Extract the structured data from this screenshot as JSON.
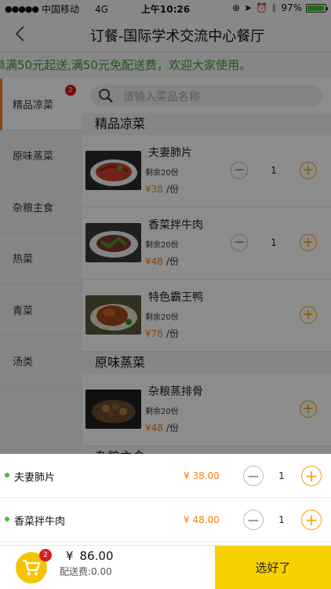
{
  "status_bar": {
    "carrier": "中国移动",
    "network": "4G",
    "time": "上午10:26",
    "battery": "97%",
    "battery_level": 0.97
  },
  "nav": {
    "title": "订餐-国际学术交流中心餐厅"
  },
  "notice": {
    "text": "单满50元起送,满50元免配送费，欢迎大家使用。"
  },
  "sidebar": {
    "categories": [
      {
        "label": "精品凉菜",
        "badge": "2"
      },
      {
        "label": "原味蒸菜"
      },
      {
        "label": "杂粮主食"
      },
      {
        "label": "热菜"
      },
      {
        "label": "青菜"
      },
      {
        "label": "汤类"
      }
    ]
  },
  "search": {
    "placeholder": "请输入菜品名称"
  },
  "sections": [
    {
      "title": "精品凉菜"
    },
    {
      "title": "原味蒸菜"
    },
    {
      "title": "杂粮主食"
    }
  ],
  "menu_items": [
    {
      "name": "夫妻肺片",
      "stock": "剩余20份",
      "price": "¥38",
      "unit": "/份",
      "qty": "1"
    },
    {
      "name": "香菜拌牛肉",
      "stock": "剩余20份",
      "price": "¥48",
      "unit": "/份",
      "qty": "1"
    },
    {
      "name": "特色霸王鸭",
      "stock": "剩余20份",
      "price": "¥78",
      "unit": "/份"
    },
    {
      "name": "杂粮蒸排骨",
      "stock": "剩余20份",
      "price": "¥48",
      "unit": "/份"
    }
  ],
  "cart": {
    "items": [
      {
        "name": "夫妻肺片",
        "price": "¥ 38.00",
        "qty": "1"
      },
      {
        "name": "香菜拌牛肉",
        "price": "¥ 48.00",
        "qty": "1"
      }
    ],
    "count_badge": "2",
    "currency": "¥",
    "total": "86.00",
    "delivery_fee": "配送费:0.00",
    "checkout_label": "选好了"
  },
  "colors": {
    "accent_orange": "#f5821f",
    "accent_yellow": "#f7d000",
    "notice_green": "#3aa238",
    "badge_red": "#d51c1c"
  }
}
